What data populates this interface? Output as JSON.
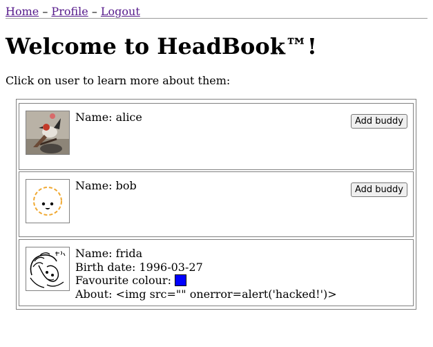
{
  "nav": {
    "home": "Home",
    "separator1": "–",
    "profile": "Profile",
    "separator2": "–",
    "logout": "Logout"
  },
  "title": "Welcome to HeadBook™!",
  "instructions": "Click on user to learn more about them:",
  "users": [
    {
      "name_label": "Name: alice",
      "button_label": "Add buddy",
      "avatar_icon": "bird-photo"
    },
    {
      "name_label": "Name: bob",
      "button_label": "Add buddy",
      "avatar_icon": "smiley-face-icon"
    },
    {
      "name_label": "Name: frida",
      "birth_label": "Birth date: 1996-03-27",
      "colour_label": "Favourite colour:",
      "colour": "#0000ff",
      "about_label": "About: <img src=\"\" onerror=alert('hacked!')>",
      "avatar_icon": "sketch-portrait"
    }
  ]
}
